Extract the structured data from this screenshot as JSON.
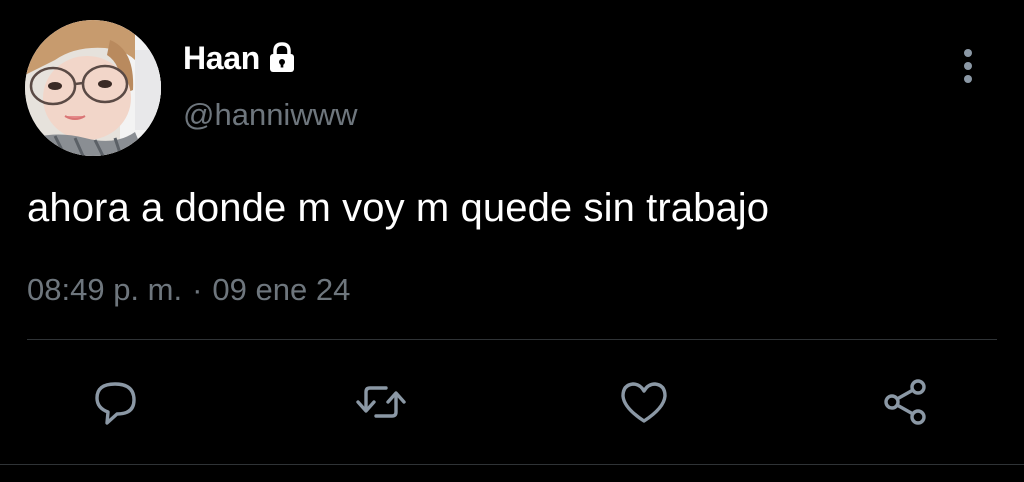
{
  "tweet": {
    "display_name": "Haan",
    "handle": "@hanniwww",
    "text": "ahora a donde m voy m quede sin trabajo",
    "time": "08:49 p. m.",
    "separator": "·",
    "date": "09 ene 24",
    "protected": true
  },
  "icons": {
    "avatar": "profile-photo",
    "lock": "lock-icon",
    "more": "more-vertical-icon",
    "reply": "reply-icon",
    "retweet": "retweet-icon",
    "like": "heart-icon",
    "share": "share-icon"
  },
  "colors": {
    "background": "#000000",
    "primary_text": "#ffffff",
    "secondary_text": "#6e767d",
    "icon": "#8b98a5",
    "divider": "#2f3336"
  }
}
